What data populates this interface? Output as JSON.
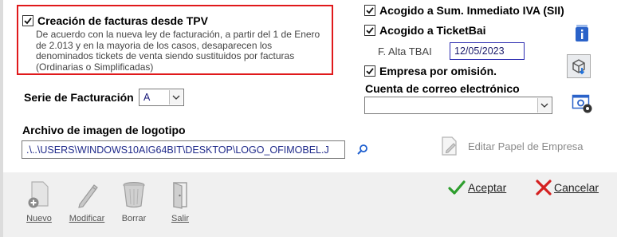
{
  "tpv": {
    "checked": true,
    "label": "Creación de facturas desde TPV",
    "description": "De acuerdo con la nueva ley de facturación, a partir del 1 de Enero de 2.013 y en la mayoria de los casos, desaparecen los denominados tickets de venta siendo sustituidos por facturas (Ordinarias o Simplificadas)"
  },
  "sii": {
    "checked": true,
    "label": "Acogido a Sum. Inmediato IVA (SII)"
  },
  "ticketbai": {
    "checked": true,
    "label": "Acogido a TicketBai",
    "date_label": "F. Alta TBAI",
    "date_value": "12/05/2023"
  },
  "empresa_omision": {
    "checked": true,
    "label": "Empresa por omisión."
  },
  "email": {
    "label": "Cuenta de correo electrónico",
    "value": ""
  },
  "serie": {
    "label": "Serie de Facturación",
    "value": "A"
  },
  "logo": {
    "label": "Archivo de imagen de logotipo",
    "path": ".\\..\\USERS\\WINDOWS10AIG64BIT\\DESKTOP\\LOGO_OFIMOBEL.J",
    "edit_paper_label": "Editar Papel de Empresa"
  },
  "toolbar": {
    "nuevo_label": "Nuevo",
    "modificar_label": "Modificar",
    "borrar_label": "Borrar",
    "salir_label": "Salir"
  },
  "dialog": {
    "accept_label": "Aceptar",
    "cancel_label": "Cancelar"
  },
  "colors": {
    "highlight_border": "#e0191b",
    "accept_check": "#2e9e2e",
    "cancel_x": "#d42020",
    "info_icon": "#2a62c9"
  },
  "icons": [
    "check-icon",
    "info-icon",
    "cube-download-icon",
    "settings-gear-icon",
    "magnifier-icon",
    "edit-document-icon",
    "new-document-icon",
    "pencil-icon",
    "trash-icon",
    "exit-door-icon",
    "checkmark-icon",
    "cross-icon",
    "chevron-down-icon"
  ]
}
